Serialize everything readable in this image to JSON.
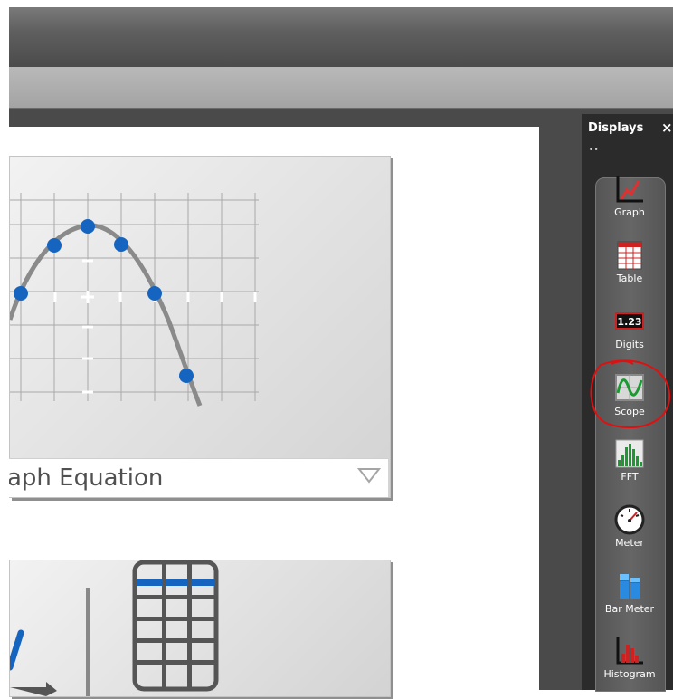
{
  "canvas": {
    "card1_caption": "aph Equation"
  },
  "panel": {
    "title": "Displays",
    "close_symbol": "×",
    "dots": "••",
    "items": [
      {
        "label": "Graph",
        "icon": "graph-icon"
      },
      {
        "label": "Table",
        "icon": "table-icon"
      },
      {
        "label": "Digits",
        "icon": "digits-icon",
        "icon_text": "1.23"
      },
      {
        "label": "Scope",
        "icon": "scope-icon"
      },
      {
        "label": "FFT",
        "icon": "fft-icon"
      },
      {
        "label": "Meter",
        "icon": "meter-icon"
      },
      {
        "label": "Bar Meter",
        "icon": "bar-meter-icon"
      },
      {
        "label": "Histogram",
        "icon": "histogram-icon"
      }
    ]
  },
  "colors": {
    "accent_blue": "#1565c0",
    "annotation_red": "#e01010",
    "curve_gray": "#8a8a8a"
  }
}
